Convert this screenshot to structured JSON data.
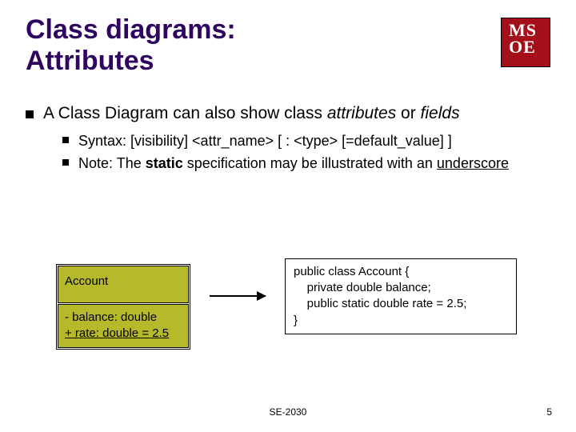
{
  "title": {
    "line1": "Class diagrams:",
    "line2": "Attributes"
  },
  "logo": {
    "line1": "MS",
    "line2": "OE"
  },
  "bullet_main": {
    "pre": "A Class Diagram can also show class ",
    "em1": "attributes",
    "mid": " or ",
    "em2": "fields"
  },
  "sub": {
    "b1": "Syntax: [visibility] <attr_name> [ : <type> [=default_value] ]",
    "b2_pre": "Note: The ",
    "b2_bold": "static",
    "b2_mid": " specification may be illustrated with an ",
    "b2_under": "underscore"
  },
  "uml": {
    "name": "Account",
    "attr1": "- balance: double",
    "attr2": "+ rate: double = 2.5"
  },
  "code": {
    "l1": "public class Account {",
    "l2": "    private double balance;",
    "l3": "    public static double rate = 2.5;",
    "l4": "}"
  },
  "footer": {
    "course": "SE-2030",
    "page": "5"
  }
}
